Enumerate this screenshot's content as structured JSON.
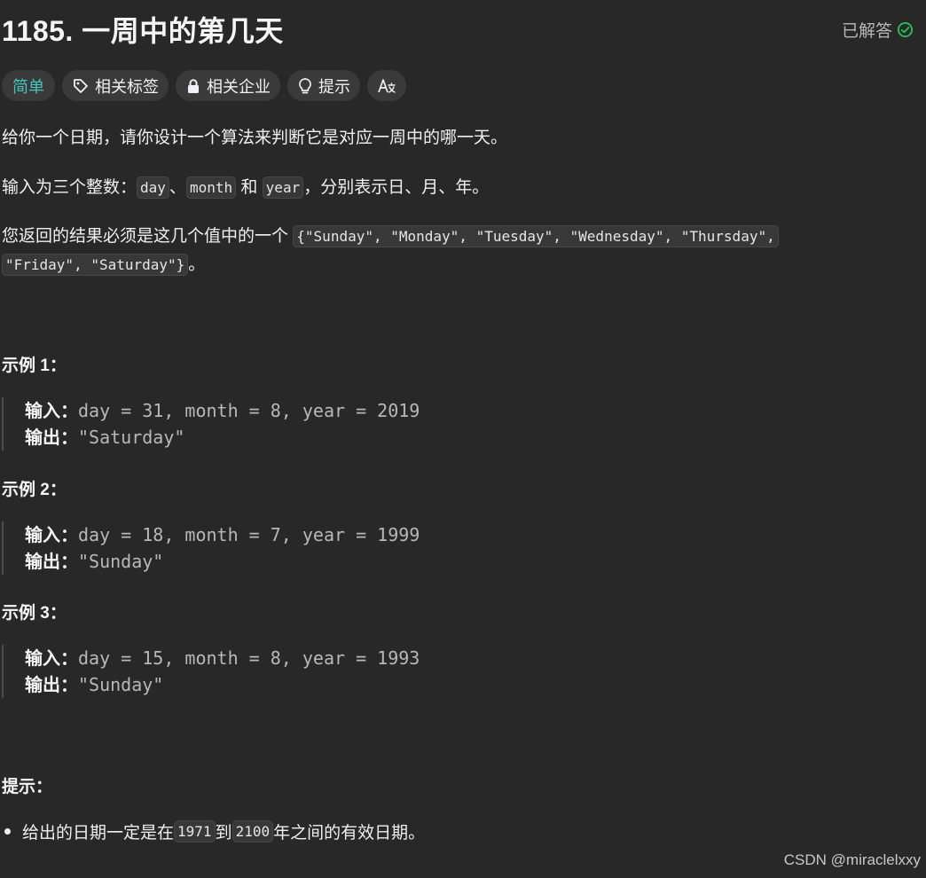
{
  "problem": {
    "title": "1185. 一周中的第几天",
    "status": "已解答"
  },
  "tags": [
    {
      "label": "简单"
    },
    {
      "label": "相关标签"
    },
    {
      "label": "相关企业"
    },
    {
      "label": "提示"
    }
  ],
  "description": {
    "p1": "给你一个日期，请你设计一个算法来判断它是对应一周中的哪一天。",
    "p2": {
      "prefix": "输入为三个整数：",
      "code1": "day",
      "sep1": "、",
      "code2": "month",
      "sep2": " 和 ",
      "code3": "year",
      "suffix": "，分别表示日、月、年。"
    },
    "p3": {
      "prefix": "您返回的结果必须是这几个值中的一个 ",
      "code_line1": "{\"Sunday\", \"Monday\", \"Tuesday\", \"Wednesday\", \"Thursday\",",
      "code_line2": "\"Friday\", \"Saturday\"}",
      "suffix": "。"
    }
  },
  "examples": [
    {
      "heading": "示例 1：",
      "input_label": "输入：",
      "input": "day = 31, month = 8, year = 2019",
      "output_label": "输出：",
      "output": "\"Saturday\""
    },
    {
      "heading": "示例 2：",
      "input_label": "输入：",
      "input": "day = 18, month = 7, year = 1999",
      "output_label": "输出：",
      "output": "\"Sunday\""
    },
    {
      "heading": "示例 3：",
      "input_label": "输入：",
      "input": "day = 15, month = 8, year = 1993",
      "output_label": "输出：",
      "output": "\"Sunday\""
    }
  ],
  "hints": {
    "heading": "提示：",
    "item": {
      "prefix": "给出的日期一定是在 ",
      "code1": "1971",
      "middle": " 到 ",
      "code2": "2100",
      "suffix": " 年之间的有效日期。"
    }
  },
  "watermark": "CSDN @miraclelxxy",
  "colors": {
    "background": "#282828",
    "easy": "#46c6c2",
    "solved_check": "#2cbb5d"
  }
}
